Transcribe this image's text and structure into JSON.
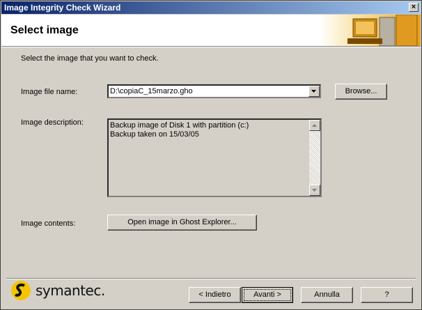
{
  "window": {
    "title": "Image Integrity Check Wizard",
    "close_glyph": "×"
  },
  "header": {
    "title": "Select image"
  },
  "instruction": "Select the image that you want to check.",
  "image_file": {
    "label": "Image file name:",
    "value": "D:\\copiaC_15marzo.gho",
    "browse_label": "Browse..."
  },
  "image_description": {
    "label": "Image description:",
    "lines": [
      "Backup image of Disk 1 with partition (c:)",
      "Backup taken on 15/03/05"
    ]
  },
  "image_contents": {
    "label": "Image contents:",
    "button_label": "Open image in Ghost Explorer..."
  },
  "footer": {
    "brand": "symantec.",
    "back_label": "< Indietro",
    "next_label": "Avanti >",
    "cancel_label": "Annulla",
    "help_label": "?"
  },
  "colors": {
    "title_start": "#0a246a",
    "title_end": "#a6caf0",
    "face": "#d4d0c8",
    "logo_yellow": "#f5c400"
  }
}
